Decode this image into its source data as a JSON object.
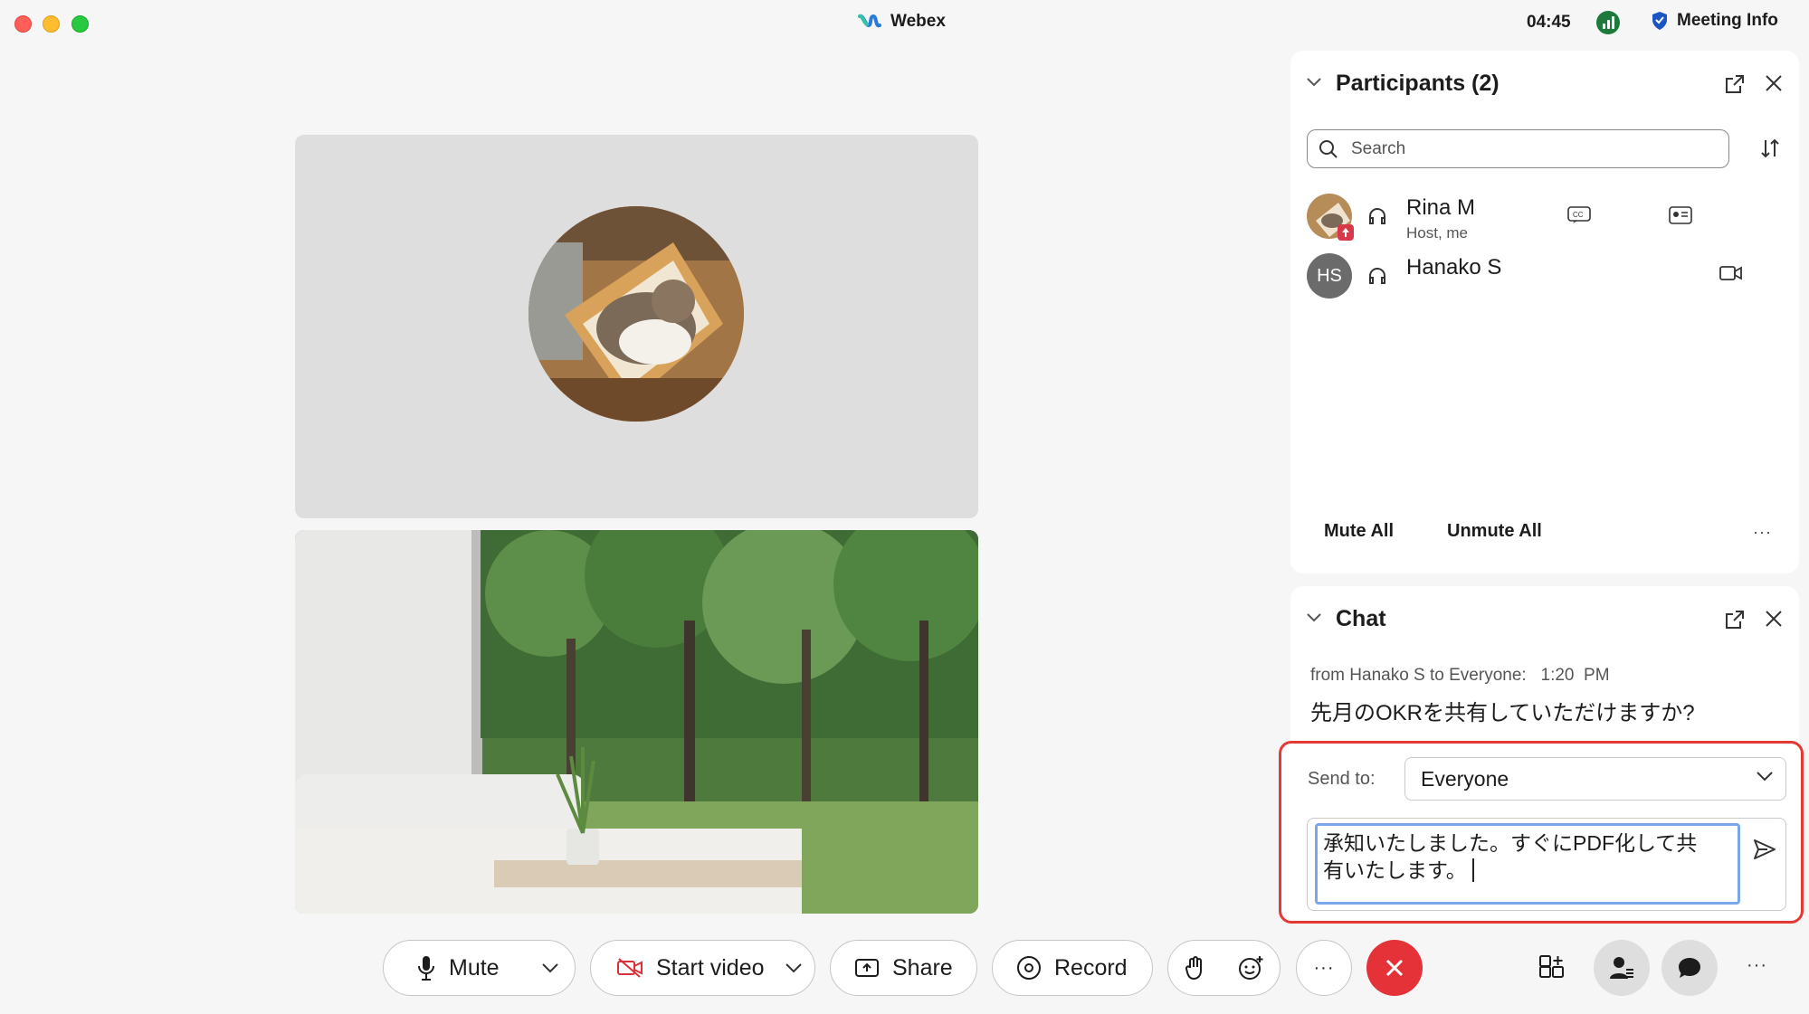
{
  "window": {
    "title": "Webex",
    "time": "04:45",
    "meeting_info": "Meeting Info"
  },
  "participants": {
    "title": "Participants (2)",
    "search_placeholder": "Search",
    "list": [
      {
        "name": "Rina M",
        "role": "Host, me"
      },
      {
        "name": "Hanako S",
        "initials": "HS"
      }
    ],
    "mute_all": "Mute All",
    "unmute_all": "Unmute All",
    "more": "···"
  },
  "chat": {
    "title": "Chat",
    "messages": [
      {
        "meta": "from Hanako S to Everyone:   1:20  PM",
        "text": "先月のOKRを共有していただけますか?"
      }
    ],
    "send_to_label": "Send to:",
    "send_to_value": "Everyone",
    "draft_line1": "承知いたしました。すぐにPDF化して共",
    "draft_line2": "有いたします。"
  },
  "toolbar": {
    "mute": "Mute",
    "start_video": "Start video",
    "share": "Share",
    "record": "Record",
    "more": "···",
    "more_right": "···"
  },
  "colors": {
    "end_call": "#e53238",
    "highlight": "#e53935",
    "signal": "#1d7a3c"
  }
}
